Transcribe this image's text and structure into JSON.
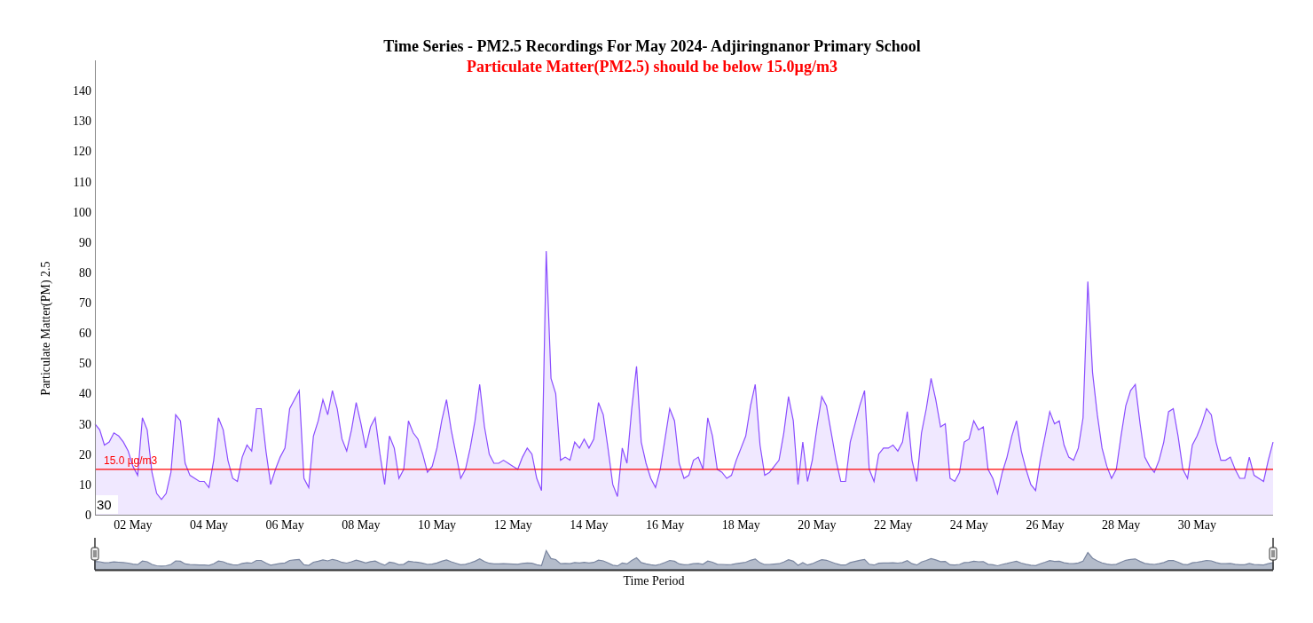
{
  "chart": {
    "subtitle": "Particulate Matter(PM2.5) should be below 15.0µg/m3",
    "corner_label": "30",
    "chart_data": {
      "type": "area",
      "title": "Time Series - PM2.5 Recordings For May 2024- Adjiringnanor Primary School",
      "xlabel": "Time Period",
      "ylabel": "Particulate Matter(PM) 2.5",
      "categories": [
        null,
        null,
        null,
        null,
        null,
        null,
        null,
        null,
        "02 May",
        null,
        null,
        null,
        null,
        null,
        null,
        null,
        null,
        null,
        null,
        null,
        null,
        null,
        null,
        null,
        "04 May",
        null,
        null,
        null,
        null,
        null,
        null,
        null,
        null,
        null,
        null,
        null,
        null,
        null,
        null,
        null,
        "06 May",
        null,
        null,
        null,
        null,
        null,
        null,
        null,
        null,
        null,
        null,
        null,
        null,
        null,
        null,
        null,
        "08 May",
        null,
        null,
        null,
        null,
        null,
        null,
        null,
        null,
        null,
        null,
        null,
        null,
        null,
        null,
        null,
        "10 May",
        null,
        null,
        null,
        null,
        null,
        null,
        null,
        null,
        null,
        null,
        null,
        null,
        null,
        null,
        null,
        "12 May",
        null,
        null,
        null,
        null,
        null,
        null,
        null,
        null,
        null,
        null,
        null,
        null,
        null,
        null,
        null,
        "14 May",
        null,
        null,
        null,
        null,
        null,
        null,
        null,
        null,
        null,
        null,
        null,
        null,
        null,
        null,
        null,
        "16 May",
        null,
        null,
        null,
        null,
        null,
        null,
        null,
        null,
        null,
        null,
        null,
        null,
        null,
        null,
        null,
        "18 May",
        null,
        null,
        null,
        null,
        null,
        null,
        null,
        null,
        null,
        null,
        null,
        null,
        null,
        null,
        null,
        "20 May",
        null,
        null,
        null,
        null,
        null,
        null,
        null,
        null,
        null,
        null,
        null,
        null,
        null,
        null,
        null,
        "22 May",
        null,
        null,
        null,
        null,
        null,
        null,
        null,
        null,
        null,
        null,
        null,
        null,
        null,
        null,
        null,
        "24 May",
        null,
        null,
        null,
        null,
        null,
        null,
        null,
        null,
        null,
        null,
        null,
        null,
        null,
        null,
        null,
        "26 May",
        null,
        null,
        null,
        null,
        null,
        null,
        null,
        null,
        null,
        null,
        null,
        null,
        null,
        null,
        null,
        "28 May",
        null,
        null,
        null,
        null,
        null,
        null,
        null,
        null,
        null,
        null,
        null,
        null,
        null,
        null,
        null,
        "30 May",
        null,
        null,
        null,
        null,
        null,
        null,
        null,
        null,
        null,
        null,
        null,
        null,
        null,
        null,
        null,
        null
      ],
      "series": [
        {
          "color": "#8a4dff",
          "values": [
            30,
            28,
            23,
            24,
            27,
            26,
            24,
            21,
            16,
            13,
            32,
            28,
            14,
            7,
            5,
            7,
            14,
            33,
            31,
            17,
            13,
            12,
            11,
            11,
            9,
            18,
            32,
            28,
            18,
            12,
            11,
            19,
            23,
            21,
            35,
            35,
            21,
            10,
            15,
            19,
            22,
            35,
            38,
            41,
            12,
            9,
            26,
            31,
            38,
            33,
            41,
            35,
            25,
            21,
            28,
            37,
            30,
            22,
            29,
            32,
            20,
            10,
            26,
            22,
            12,
            15,
            31,
            27,
            25,
            20,
            14,
            16,
            22,
            31,
            38,
            28,
            20,
            12,
            15,
            22,
            31,
            43,
            29,
            20,
            17,
            17,
            18,
            17,
            16,
            15,
            19,
            22,
            20,
            12,
            8,
            87,
            45,
            40,
            18,
            19,
            18,
            24,
            22,
            25,
            22,
            25,
            37,
            33,
            22,
            10,
            6,
            22,
            17,
            35,
            49,
            24,
            17,
            12,
            9,
            15,
            25,
            35,
            31,
            17,
            12,
            13,
            18,
            19,
            15,
            32,
            26,
            15,
            14,
            12,
            13,
            18,
            22,
            26,
            36,
            43,
            23,
            13,
            14,
            16,
            18,
            27,
            39,
            31,
            10,
            24,
            11,
            18,
            29,
            39,
            36,
            27,
            18,
            11,
            11,
            24,
            30,
            36,
            41,
            15,
            11,
            20,
            22,
            22,
            23,
            21,
            24,
            34,
            18,
            11,
            27,
            35,
            45,
            38,
            29,
            30,
            12,
            11,
            14,
            24,
            25,
            31,
            28,
            29,
            15,
            12,
            7,
            14,
            19,
            26,
            31,
            21,
            15,
            10,
            8,
            18,
            26,
            34,
            30,
            31,
            23,
            19,
            18,
            22,
            32,
            77,
            47,
            33,
            22,
            16,
            12,
            15,
            26,
            36,
            41,
            43,
            30,
            19,
            16,
            14,
            18,
            24,
            34,
            35,
            26,
            15,
            12,
            23,
            26,
            30,
            35,
            33,
            24,
            18,
            18,
            19,
            15,
            12,
            12,
            19,
            13,
            12,
            11,
            18,
            24
          ]
        }
      ],
      "ylim": [
        0,
        150
      ],
      "yticks": [
        0,
        10,
        20,
        30,
        40,
        50,
        60,
        70,
        80,
        90,
        100,
        110,
        120,
        130,
        140
      ],
      "ref_lines": [
        {
          "axis": "y",
          "value": 15,
          "label": "15.0 µg/m3"
        }
      ]
    }
  }
}
